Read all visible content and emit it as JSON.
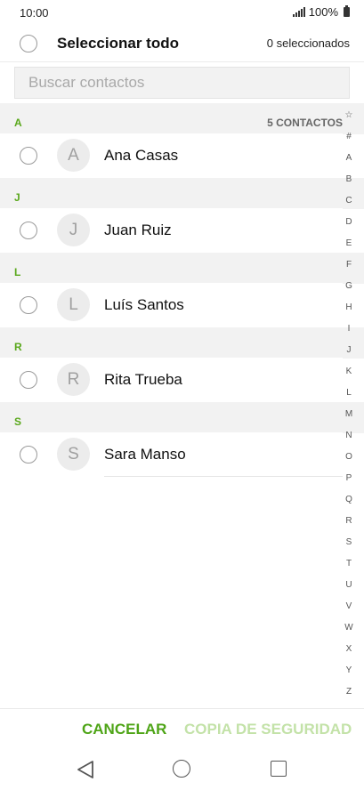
{
  "status": {
    "time": "10:00",
    "battery": "100%"
  },
  "header": {
    "select_all": "Seleccionar todo",
    "selected_count": "0 seleccionados"
  },
  "search": {
    "placeholder": "Buscar contactos"
  },
  "contacts_count": "5 CONTACTOS",
  "sections": [
    {
      "letter": "A",
      "contact": {
        "initial": "A",
        "name": "Ana Casas"
      }
    },
    {
      "letter": "J",
      "contact": {
        "initial": "J",
        "name": "Juan Ruiz"
      }
    },
    {
      "letter": "L",
      "contact": {
        "initial": "L",
        "name": "Luís Santos"
      }
    },
    {
      "letter": "R",
      "contact": {
        "initial": "R",
        "name": "Rita Trueba"
      }
    },
    {
      "letter": "S",
      "contact": {
        "initial": "S",
        "name": "Sara Manso"
      }
    }
  ],
  "index_letters": [
    "☆",
    "#",
    "A",
    "B",
    "C",
    "D",
    "E",
    "F",
    "G",
    "H",
    "I",
    "J",
    "K",
    "L",
    "M",
    "N",
    "O",
    "P",
    "Q",
    "R",
    "S",
    "T",
    "U",
    "V",
    "W",
    "X",
    "Y",
    "Z"
  ],
  "actions": {
    "cancel": "CANCELAR",
    "backup": "COPIA DE SEGURIDAD"
  },
  "colors": {
    "accent": "#4fa518",
    "accent_disabled": "#c3e2a8",
    "section_bg": "#f2f2f2"
  },
  "nav": {
    "back_icon": "back-triangle-icon",
    "home_icon": "home-circle-icon",
    "recent_icon": "recent-square-icon"
  }
}
